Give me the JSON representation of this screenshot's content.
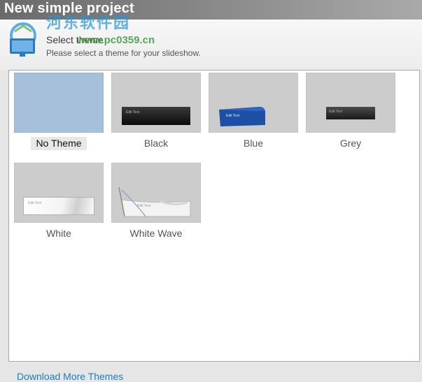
{
  "window": {
    "title": "New simple project"
  },
  "watermark": {
    "site_name": "河东软件园",
    "url": "www.pc0359.cn"
  },
  "header": {
    "heading": "Select theme",
    "subtitle": "Please select a theme for your slideshow."
  },
  "themes": [
    {
      "label": "No Theme",
      "selected": true
    },
    {
      "label": "Black",
      "selected": false
    },
    {
      "label": "Blue",
      "selected": false
    },
    {
      "label": "Grey",
      "selected": false
    },
    {
      "label": "White",
      "selected": false
    },
    {
      "label": "White Wave",
      "selected": false
    }
  ],
  "thumb_caption": "Edit Text",
  "footer": {
    "link": "Download More Themes"
  },
  "colors": {
    "selected_thumb": "#a6c0dc",
    "thumb_bg": "#cccccc",
    "link": "#1a7fc1",
    "blue_theme": "#1d4fa6"
  }
}
